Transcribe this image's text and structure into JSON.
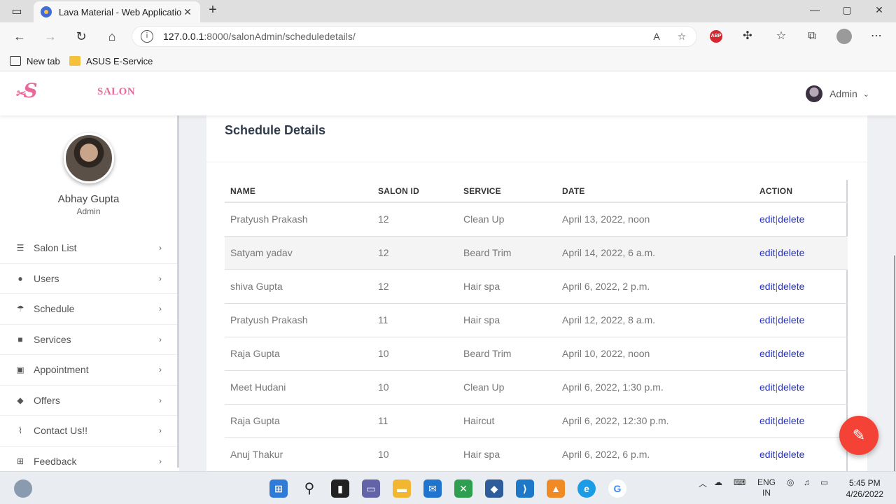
{
  "browser": {
    "tab_title": "Lava Material - Web Application",
    "tab_close": "✕",
    "new_tab": "+",
    "url_host": "127.0.0.1",
    "url_rest": ":8000/salonAdmin/scheduledetails/",
    "bookmarks": [
      "New tab",
      "ASUS E-Service"
    ]
  },
  "header": {
    "logo": "S",
    "brand": "SALON",
    "user": "Admin"
  },
  "sidebar": {
    "name": "Abhay Gupta",
    "role": "Admin",
    "items": [
      {
        "label": "Salon List",
        "icon": "list-icon",
        "glyph": "☰"
      },
      {
        "label": "Users",
        "icon": "user-icon",
        "glyph": "●"
      },
      {
        "label": "Schedule",
        "icon": "umbrella-icon",
        "glyph": "☂"
      },
      {
        "label": "Services",
        "icon": "save-icon",
        "glyph": "■"
      },
      {
        "label": "Appointment",
        "icon": "image-icon",
        "glyph": "▣"
      },
      {
        "label": "Offers",
        "icon": "tags-icon",
        "glyph": "◆"
      },
      {
        "label": "Contact Us!!",
        "icon": "rss-icon",
        "glyph": "⌇"
      },
      {
        "label": "Feedback",
        "icon": "plus-square-icon",
        "glyph": "⊞"
      }
    ]
  },
  "main": {
    "title": "Schedule Details",
    "columns": [
      "NAME",
      "SALON ID",
      "SERVICE",
      "DATE",
      "ACTION"
    ],
    "rows": [
      {
        "name": "Pratyush Prakash",
        "salon_id": "12",
        "service": "Clean Up",
        "date": "April 13, 2022, noon"
      },
      {
        "name": "Satyam yadav",
        "salon_id": "12",
        "service": "Beard Trim",
        "date": "April 14, 2022, 6 a.m."
      },
      {
        "name": "shiva Gupta",
        "salon_id": "12",
        "service": "Hair spa",
        "date": "April 6, 2022, 2 p.m."
      },
      {
        "name": "Pratyush Prakash",
        "salon_id": "11",
        "service": "Hair spa",
        "date": "April 12, 2022, 8 a.m."
      },
      {
        "name": "Raja Gupta",
        "salon_id": "10",
        "service": "Beard Trim",
        "date": "April 10, 2022, noon"
      },
      {
        "name": "Meet Hudani",
        "salon_id": "10",
        "service": "Clean Up",
        "date": "April 6, 2022, 1:30 p.m."
      },
      {
        "name": "Raja Gupta",
        "salon_id": "11",
        "service": "Haircut",
        "date": "April 6, 2022, 12:30 p.m."
      },
      {
        "name": "Anuj Thakur",
        "salon_id": "10",
        "service": "Hair spa",
        "date": "April 6, 2022, 6 p.m."
      }
    ],
    "edit_label": "edit",
    "action_sep": "|",
    "delete_label": "delete"
  },
  "taskbar": {
    "lang": "ENG",
    "region": "IN",
    "time": "5:45 PM",
    "date": "4/26/2022"
  },
  "colors": {
    "brand": "#e96a9a",
    "link": "#2431c9",
    "fab": "#f44336"
  }
}
